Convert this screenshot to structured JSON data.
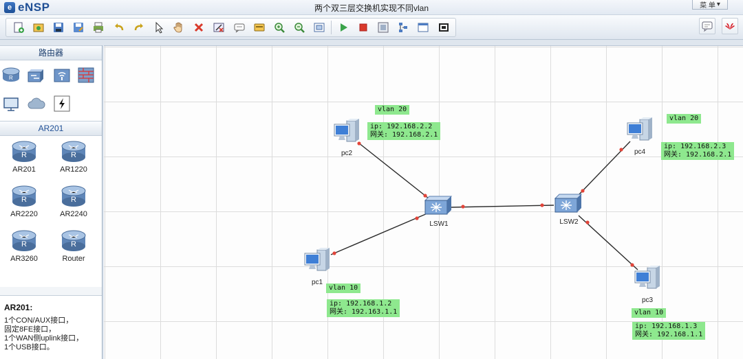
{
  "app": {
    "logo_text": "eNSP",
    "window_title": "两个双三层交换机实现不同vlan",
    "menu_label": "菜 单"
  },
  "toolbar": {
    "buttons": [
      "new-topology",
      "open",
      "save",
      "save-as",
      "print",
      "undo",
      "redo",
      "select",
      "pan",
      "delete",
      "delete-all-links",
      "text-note",
      "palette",
      "zoom-in",
      "zoom-out",
      "fit-window",
      "start-all",
      "stop-all",
      "capture-data",
      "topology-view",
      "cli-window",
      "screenshot"
    ],
    "right_buttons": [
      "feedback",
      "huawei-home"
    ]
  },
  "left_panel": {
    "router_section_title": "路由器",
    "categories": [
      "router-category",
      "switch-category",
      "wireless-category",
      "firewall-category",
      "terminal-category",
      "cloud-category",
      "connection-category"
    ],
    "device_section_title": "AR201",
    "devices": [
      {
        "label": "AR201"
      },
      {
        "label": "AR1220"
      },
      {
        "label": "AR2220"
      },
      {
        "label": "AR2240"
      },
      {
        "label": "AR3260"
      },
      {
        "label": "Router"
      }
    ],
    "info": {
      "title": "AR201:",
      "lines": [
        "1个CON/AUX接口，",
        "固定8FE接口，",
        "1个WAN侧uplink接口，",
        "1个USB接口。"
      ]
    }
  },
  "topology": {
    "devices": {
      "pc2": "pc2",
      "pc4": "pc4",
      "lsw1": "LSW1",
      "lsw2": "LSW2",
      "pc1": "pc1",
      "pc3": "pc3"
    },
    "notes": {
      "pc2_vlan": "vlan 20",
      "pc2_ip": "ip: 192.168.2.2",
      "pc2_gw": "网关: 192.168.2.1",
      "pc4_vlan": "vlan 20",
      "pc4_ip": "ip: 192.168.2.3",
      "pc4_gw": "网关: 192.168.2.1",
      "pc1_vlan": "vlan 10",
      "pc1_ip": "ip: 192.168.1.2",
      "pc1_gw": "网关: 192.163.1.1",
      "pc3_vlan": "vlan 10",
      "pc3_ip": "ip: 192.168.1.3",
      "pc3_gw": "网关: 192.168.1.1"
    },
    "colors": {
      "note_bg": "#8ee88e",
      "link": "#2b2b2b",
      "port_dot": "#e2453a"
    }
  }
}
